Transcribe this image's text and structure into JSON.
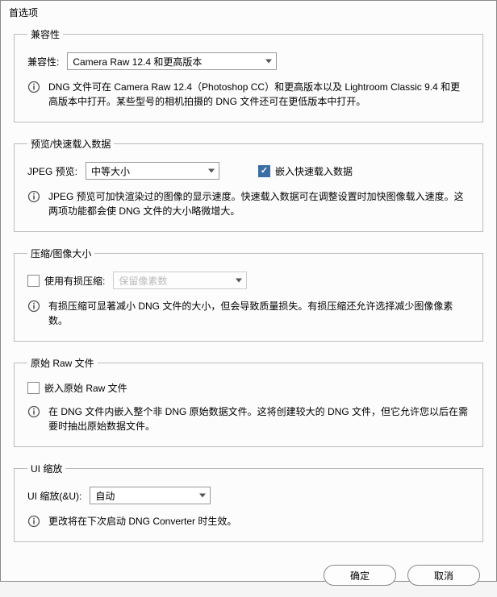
{
  "window": {
    "title": "首选项"
  },
  "compat": {
    "legend": "兼容性",
    "label": "兼容性:",
    "select_value": "Camera Raw 12.4 和更高版本",
    "info": "DNG 文件可在 Camera Raw 12.4（Photoshop CC）和更高版本以及 Lightroom Classic 9.4 和更高版本中打开。某些型号的相机拍摄的 DNG 文件还可在更低版本中打开。"
  },
  "preview": {
    "legend": "预览/快速载入数据",
    "jpeg_label": "JPEG 预览:",
    "jpeg_value": "中等大小",
    "embed_label": "嵌入快速载入数据",
    "embed_checked": true,
    "info": "JPEG 预览可加快渲染过的图像的显示速度。快速载入数据可在调整设置时加快图像载入速度。这两项功能都会使 DNG 文件的大小略微增大。"
  },
  "compress": {
    "legend": "压缩/图像大小",
    "lossy_label": "使用有损压缩:",
    "lossy_checked": false,
    "lossy_select_value": "保留像素数",
    "info": "有损压缩可显著减小 DNG 文件的大小，但会导致质量损失。有损压缩还允许选择减少图像像素数。"
  },
  "rawfile": {
    "legend": "原始 Raw 文件",
    "embed_label": "嵌入原始 Raw 文件",
    "embed_checked": false,
    "info": "在 DNG 文件内嵌入整个非 DNG 原始数据文件。这将创建较大的 DNG 文件，但它允许您以后在需要时抽出原始数据文件。"
  },
  "uiscale": {
    "legend": "UI 缩放",
    "label": "UI 缩放(&U):",
    "value": "自动",
    "info": "更改将在下次启动 DNG Converter 时生效。"
  },
  "buttons": {
    "ok": "确定",
    "cancel": "取消"
  }
}
